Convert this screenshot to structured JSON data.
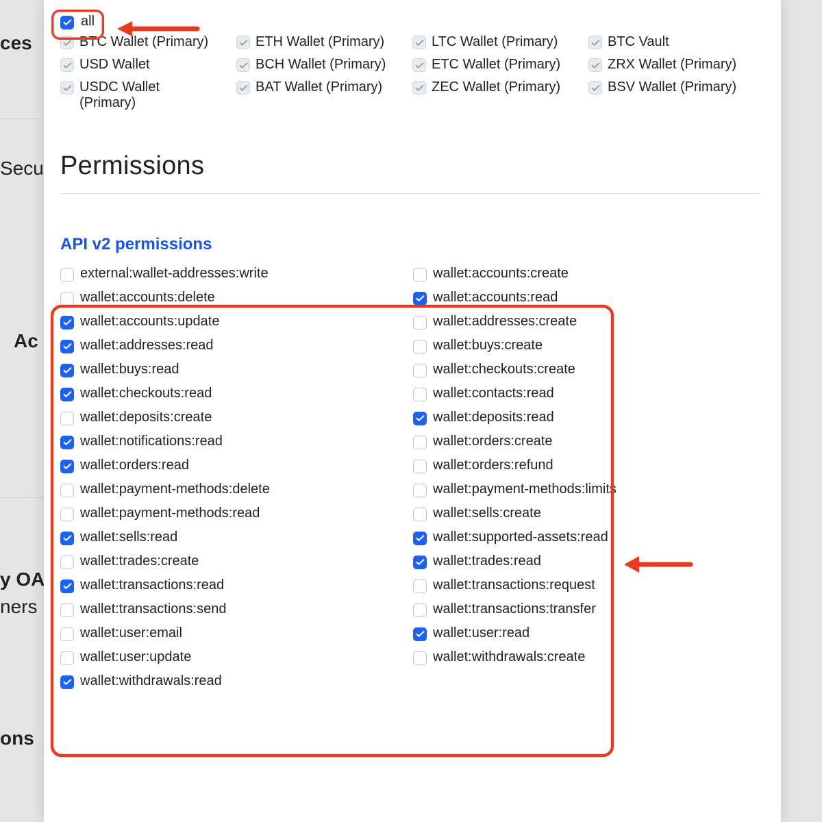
{
  "background": {
    "item1": "ces",
    "item2": "Securi",
    "item3": "Ac",
    "item4": "y OA",
    "item5": "ners u",
    "item6": "ons"
  },
  "wallets": {
    "all_label": "all",
    "items": [
      {
        "label": "BTC Wallet (Primary)",
        "checked": true
      },
      {
        "label": "ETH Wallet (Primary)",
        "checked": true
      },
      {
        "label": "LTC Wallet (Primary)",
        "checked": true
      },
      {
        "label": "BTC Vault",
        "checked": true
      },
      {
        "label": "USD Wallet",
        "checked": true
      },
      {
        "label": "BCH Wallet (Primary)",
        "checked": true
      },
      {
        "label": "ETC Wallet (Primary)",
        "checked": true
      },
      {
        "label": "ZRX Wallet (Primary)",
        "checked": true
      },
      {
        "label": "USDC Wallet (Primary)",
        "checked": true
      },
      {
        "label": "BAT Wallet (Primary)",
        "checked": true
      },
      {
        "label": "ZEC Wallet (Primary)",
        "checked": true
      },
      {
        "label": "BSV Wallet (Primary)",
        "checked": true
      }
    ]
  },
  "permissions_heading": "Permissions",
  "api_heading": "API v2 permissions",
  "permissions": [
    {
      "label": "external:wallet-addresses:write",
      "checked": false
    },
    {
      "label": "wallet:accounts:create",
      "checked": false
    },
    {
      "label": "wallet:accounts:delete",
      "checked": false
    },
    {
      "label": "wallet:accounts:read",
      "checked": true
    },
    {
      "label": "wallet:accounts:update",
      "checked": true
    },
    {
      "label": "wallet:addresses:create",
      "checked": false
    },
    {
      "label": "wallet:addresses:read",
      "checked": true
    },
    {
      "label": "wallet:buys:create",
      "checked": false
    },
    {
      "label": "wallet:buys:read",
      "checked": true
    },
    {
      "label": "wallet:checkouts:create",
      "checked": false
    },
    {
      "label": "wallet:checkouts:read",
      "checked": true
    },
    {
      "label": "wallet:contacts:read",
      "checked": false
    },
    {
      "label": "wallet:deposits:create",
      "checked": false
    },
    {
      "label": "wallet:deposits:read",
      "checked": true
    },
    {
      "label": "wallet:notifications:read",
      "checked": true
    },
    {
      "label": "wallet:orders:create",
      "checked": false
    },
    {
      "label": "wallet:orders:read",
      "checked": true
    },
    {
      "label": "wallet:orders:refund",
      "checked": false
    },
    {
      "label": "wallet:payment-methods:delete",
      "checked": false
    },
    {
      "label": "wallet:payment-methods:limits",
      "checked": false
    },
    {
      "label": "wallet:payment-methods:read",
      "checked": false
    },
    {
      "label": "wallet:sells:create",
      "checked": false
    },
    {
      "label": "wallet:sells:read",
      "checked": true
    },
    {
      "label": "wallet:supported-assets:read",
      "checked": true
    },
    {
      "label": "wallet:trades:create",
      "checked": false
    },
    {
      "label": "wallet:trades:read",
      "checked": true
    },
    {
      "label": "wallet:transactions:read",
      "checked": true
    },
    {
      "label": "wallet:transactions:request",
      "checked": false
    },
    {
      "label": "wallet:transactions:send",
      "checked": false
    },
    {
      "label": "wallet:transactions:transfer",
      "checked": false
    },
    {
      "label": "wallet:user:email",
      "checked": false
    },
    {
      "label": "wallet:user:read",
      "checked": true
    },
    {
      "label": "wallet:user:update",
      "checked": false
    },
    {
      "label": "wallet:withdrawals:create",
      "checked": false
    },
    {
      "label": "wallet:withdrawals:read",
      "checked": true
    }
  ]
}
